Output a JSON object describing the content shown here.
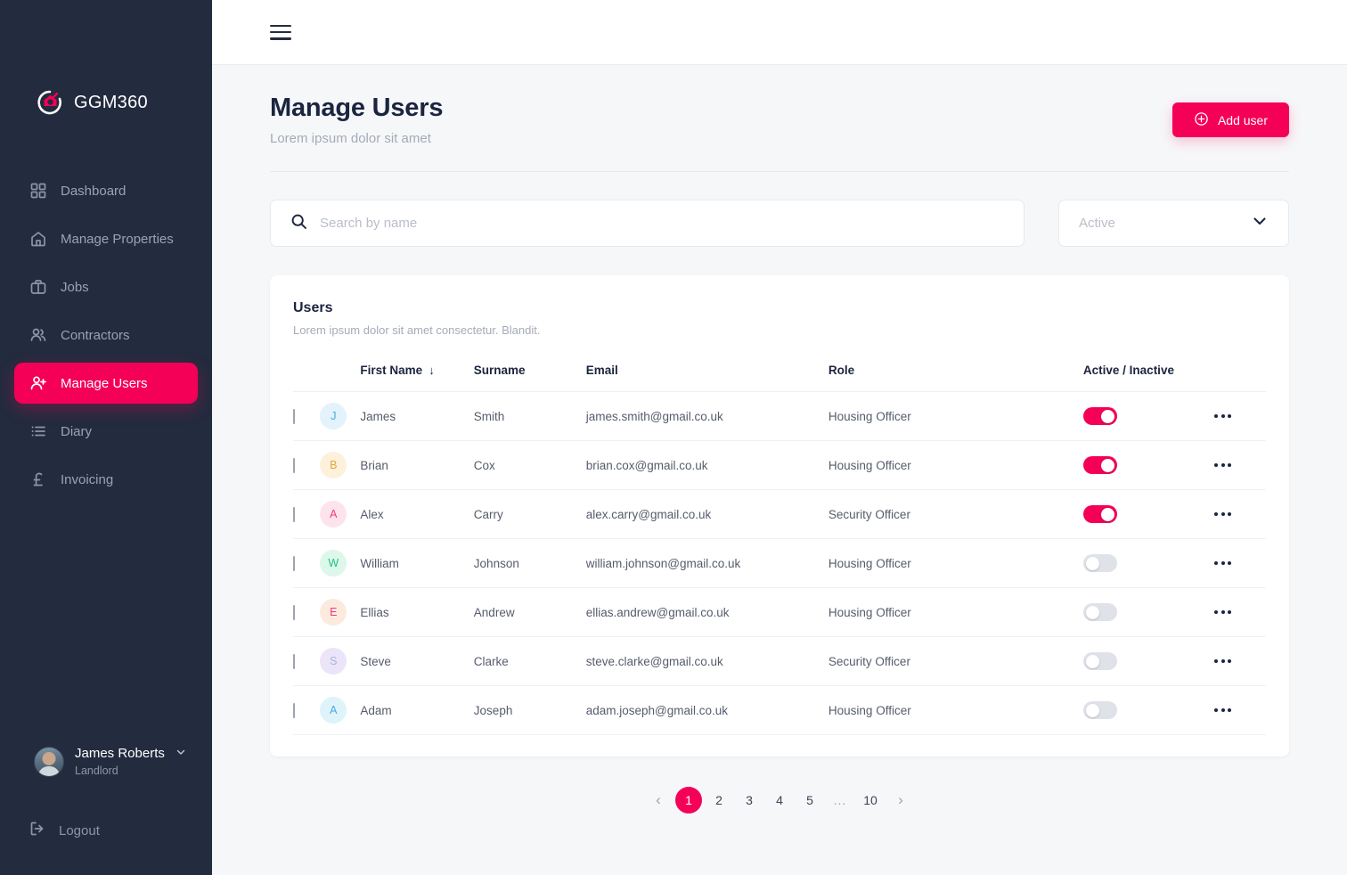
{
  "brand": {
    "name": "GGM360",
    "logo_icon": "ggm-circle-house-logo"
  },
  "sidebar": {
    "items": [
      {
        "label": "Dashboard",
        "icon": "grid-icon",
        "active": false
      },
      {
        "label": "Manage Properties",
        "icon": "home-icon",
        "active": false
      },
      {
        "label": "Jobs",
        "icon": "briefcase-icon",
        "active": false
      },
      {
        "label": "Contractors",
        "icon": "users-icon",
        "active": false
      },
      {
        "label": "Manage Users",
        "icon": "user-plus-icon",
        "active": true
      },
      {
        "label": "Diary",
        "icon": "list-icon",
        "active": false
      },
      {
        "label": "Invoicing",
        "icon": "pound-icon",
        "active": false
      }
    ],
    "profile": {
      "name": "James Roberts",
      "role": "Landlord",
      "chevron_icon": "chevron-down-icon"
    },
    "logout": {
      "label": "Logout",
      "icon": "logout-icon"
    }
  },
  "topbar": {
    "menu_icon": "hamburger-icon"
  },
  "page": {
    "title": "Manage Users",
    "subtitle": "Lorem ipsum dolor sit amet",
    "add_button": {
      "label": "Add user",
      "icon": "plus-circle-icon"
    }
  },
  "filters": {
    "search": {
      "placeholder": "Search by name",
      "value": "",
      "icon": "search-icon"
    },
    "status_select": {
      "value": "Active",
      "icon": "chevron-down-icon"
    }
  },
  "table": {
    "title": "Users",
    "subtitle": "Lorem ipsum dolor sit amet consectetur. Blandit.",
    "columns": {
      "first_name": "First Name",
      "surname": "Surname",
      "email": "Email",
      "role": "Role",
      "active": "Active / Inactive"
    },
    "sort_icon": "arrow-down-icon",
    "more_icon": "ellipsis-icon",
    "rows": [
      {
        "initial": "J",
        "first_name": "James",
        "surname": "Smith",
        "email": "james.smith@gmail.co.uk",
        "role": "Housing Officer",
        "active": true,
        "avatar_bg": "#e3f2fb",
        "avatar_fg": "#4aa8e0"
      },
      {
        "initial": "B",
        "first_name": "Brian",
        "surname": "Cox",
        "email": "brian.cox@gmail.co.uk",
        "role": "Housing Officer",
        "active": true,
        "avatar_bg": "#fdf1dc",
        "avatar_fg": "#e8a33d"
      },
      {
        "initial": "A",
        "first_name": "Alex",
        "surname": "Carry",
        "email": "alex.carry@gmail.co.uk",
        "role": "Security Officer",
        "active": true,
        "avatar_bg": "#fde4ec",
        "avatar_fg": "#ef3c78"
      },
      {
        "initial": "W",
        "first_name": "William",
        "surname": "Johnson",
        "email": "william.johnson@gmail.co.uk",
        "role": "Housing Officer",
        "active": false,
        "avatar_bg": "#ddf7ea",
        "avatar_fg": "#20c482"
      },
      {
        "initial": "E",
        "first_name": "Ellias",
        "surname": "Andrew",
        "email": "ellias.andrew@gmail.co.uk",
        "role": "Housing Officer",
        "active": false,
        "avatar_bg": "#fdeadf",
        "avatar_fg": "#ef3c78"
      },
      {
        "initial": "S",
        "first_name": "Steve",
        "surname": "Clarke",
        "email": "steve.clarke@gmail.co.uk",
        "role": "Security Officer",
        "active": false,
        "avatar_bg": "#ece4f8",
        "avatar_fg": "#a8b8d8"
      },
      {
        "initial": "A",
        "first_name": "Adam",
        "surname": "Joseph",
        "email": "adam.joseph@gmail.co.uk",
        "role": "Housing Officer",
        "active": false,
        "avatar_bg": "#dff3fb",
        "avatar_fg": "#4aa8e0"
      }
    ]
  },
  "pagination": {
    "prev_icon": "chevron-left-icon",
    "next_icon": "chevron-right-icon",
    "pages": [
      "1",
      "2",
      "3",
      "4",
      "5",
      "...",
      "10"
    ],
    "current": "1"
  },
  "colors": {
    "accent": "#f50057",
    "sidebar": "#232b3e",
    "page_bg": "#f6f7f9",
    "text_dark": "#1b2440"
  }
}
